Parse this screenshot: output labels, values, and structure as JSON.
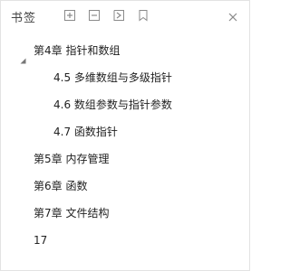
{
  "panel": {
    "title": "书签",
    "icons": {
      "add": "add-bookmark-icon",
      "remove": "delete-bookmark-icon",
      "expand": "expand-bookmark-icon",
      "bookmark": "bookmark-icon",
      "close": "close-icon",
      "collapse_arrow": "caret-down-icon"
    }
  },
  "bookmarks": [
    {
      "label": "第4章  指针和数组"
    },
    {
      "label": "4.5  多维数组与多级指针"
    },
    {
      "label": "4.6  数组参数与指针参数"
    },
    {
      "label": "4.7  函数指针"
    },
    {
      "label": "第5章  内存管理"
    },
    {
      "label": "第6章  函数"
    },
    {
      "label": "第7章  文件结构"
    },
    {
      "label": "17"
    }
  ],
  "colors": {
    "text": "#222222",
    "icon": "#8a8a8a",
    "border": "#e3e3e3"
  }
}
